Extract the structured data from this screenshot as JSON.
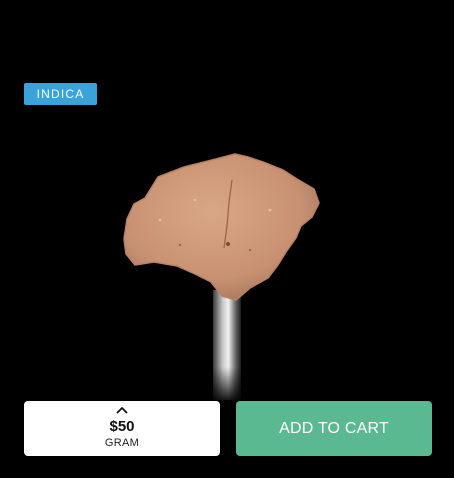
{
  "product": {
    "strain_type": "INDICA",
    "image_icon": "concentrate-on-dabber-icon"
  },
  "price_selector": {
    "price": "$50",
    "unit": "GRAM",
    "icon": "chevron-up-icon"
  },
  "cart": {
    "add_label": "ADD TO CART"
  },
  "colors": {
    "background": "#000000",
    "badge": "#3aa3d9",
    "add_to_cart": "#5ab990",
    "selector_bg": "#ffffff"
  }
}
